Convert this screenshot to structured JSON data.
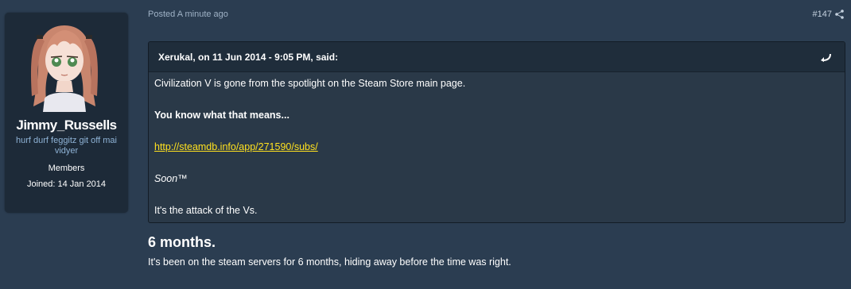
{
  "author": {
    "username": "Jimmy_Russells",
    "title": "hurf durf feggitz git off mai vidyer",
    "group": "Members",
    "joined": "Joined: 14 Jan 2014",
    "avatar_icon": "anime-girl-avatar"
  },
  "post": {
    "meta": "Posted A minute ago",
    "number": "#147",
    "share_icon": "share-icon",
    "quote": {
      "citation": "Xerukal, on 11 Jun 2014 - 9:05 PM, said:",
      "jump_icon": "quote-jump-icon",
      "lines": [
        "Civilization V is gone from the spotlight on the Steam Store main page.",
        "You know what that means...",
        "http://steamdb.info/app/271590/subs/",
        "Soon™",
        "It's the attack of the Vs."
      ]
    },
    "heading": "6 months.",
    "text": "It's been on the steam servers for 6 months, hiding away before the time was right."
  },
  "colors": {
    "background": "#2b3d51",
    "card": "#1d2a38",
    "link": "#ffe11f",
    "user_title": "#8fb3d6"
  }
}
